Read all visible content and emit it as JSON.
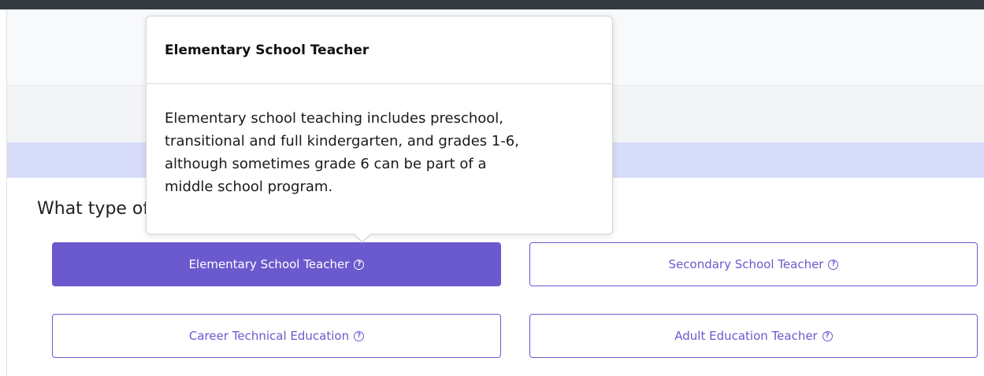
{
  "question": {
    "text": "What type of teacher are you interested in becoming?"
  },
  "options": [
    {
      "label": "Elementary School Teacher",
      "selected": true
    },
    {
      "label": "Secondary School Teacher",
      "selected": false
    },
    {
      "label": "Career Technical Education",
      "selected": false
    },
    {
      "label": "Adult Education Teacher",
      "selected": false
    }
  ],
  "help_icon": "question-circle-icon",
  "popover": {
    "title": "Elementary School Teacher",
    "body_lines": [
      "Elementary school teaching includes preschool,",
      "transitional and full kindergarten, and grades 1-6,",
      "although sometimes grade 6 can be part of a",
      "middle school program."
    ]
  },
  "colors": {
    "accent": "#6a5acd",
    "top_bar": "#343a40",
    "band_light": "#f8f9fb",
    "band_mid": "#f3f4f6",
    "band_lavender": "#d7dcf9"
  }
}
